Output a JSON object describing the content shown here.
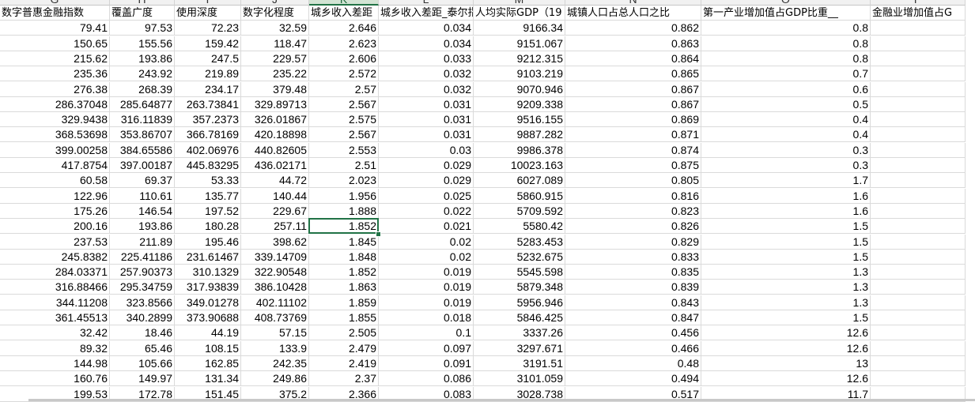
{
  "sheet": {
    "columns": [
      "G",
      "H",
      "I",
      "J",
      "K",
      "L",
      "M",
      "N",
      "O",
      "P"
    ],
    "selected_column": "K",
    "selected_cell": "K21",
    "headers": [
      "数字普惠金融指数",
      "覆盖广度",
      "使用深度",
      "数字化程度",
      "城乡收入差距",
      "城乡收入差距_泰尔指数",
      "人均实际GDP（19",
      "城镇人口占总人口之比",
      "第一产业增加值占GDP比重__",
      "金融业增加值占G"
    ],
    "rows": [
      [
        "79.41",
        "97.53",
        "72.23",
        "32.59",
        "2.646",
        "0.034",
        "9166.34",
        "0.862",
        "0.8",
        ""
      ],
      [
        "150.65",
        "155.56",
        "159.42",
        "118.47",
        "2.623",
        "0.034",
        "9151.067",
        "0.863",
        "0.8",
        ""
      ],
      [
        "215.62",
        "193.86",
        "247.5",
        "229.57",
        "2.606",
        "0.033",
        "9212.315",
        "0.864",
        "0.8",
        ""
      ],
      [
        "235.36",
        "243.92",
        "219.89",
        "235.22",
        "2.572",
        "0.032",
        "9103.219",
        "0.865",
        "0.7",
        ""
      ],
      [
        "276.38",
        "268.39",
        "234.17",
        "379.48",
        "2.57",
        "0.032",
        "9070.946",
        "0.867",
        "0.6",
        ""
      ],
      [
        "286.37048",
        "285.64877",
        "263.73841",
        "329.89713",
        "2.567",
        "0.031",
        "9209.338",
        "0.867",
        "0.5",
        ""
      ],
      [
        "329.9438",
        "316.11839",
        "357.2373",
        "326.01867",
        "2.575",
        "0.031",
        "9516.155",
        "0.869",
        "0.4",
        ""
      ],
      [
        "368.53698",
        "353.86707",
        "366.78169",
        "420.18898",
        "2.567",
        "0.031",
        "9887.282",
        "0.871",
        "0.4",
        ""
      ],
      [
        "399.00258",
        "384.65586",
        "402.06976",
        "440.82605",
        "2.553",
        "0.03",
        "9986.378",
        "0.874",
        "0.3",
        ""
      ],
      [
        "417.8754",
        "397.00187",
        "445.83295",
        "436.02171",
        "2.51",
        "0.029",
        "10023.163",
        "0.875",
        "0.3",
        ""
      ],
      [
        "60.58",
        "69.37",
        "53.33",
        "44.72",
        "2.023",
        "0.029",
        "6027.089",
        "0.805",
        "1.7",
        ""
      ],
      [
        "122.96",
        "110.61",
        "135.77",
        "140.44",
        "1.956",
        "0.025",
        "5860.915",
        "0.816",
        "1.6",
        ""
      ],
      [
        "175.26",
        "146.54",
        "197.52",
        "229.67",
        "1.888",
        "0.022",
        "5709.592",
        "0.823",
        "1.6",
        ""
      ],
      [
        "200.16",
        "193.86",
        "180.28",
        "257.11",
        "1.852",
        "0.021",
        "5580.42",
        "0.826",
        "1.5",
        ""
      ],
      [
        "237.53",
        "211.89",
        "195.46",
        "398.62",
        "1.845",
        "0.02",
        "5283.453",
        "0.829",
        "1.5",
        ""
      ],
      [
        "245.8382",
        "225.41186",
        "231.61467",
        "339.14709",
        "1.848",
        "0.02",
        "5232.675",
        "0.833",
        "1.5",
        ""
      ],
      [
        "284.03371",
        "257.90373",
        "310.1329",
        "322.90548",
        "1.852",
        "0.019",
        "5545.598",
        "0.835",
        "1.3",
        ""
      ],
      [
        "316.88466",
        "295.34759",
        "317.93839",
        "386.10428",
        "1.863",
        "0.019",
        "5879.348",
        "0.839",
        "1.3",
        ""
      ],
      [
        "344.11208",
        "323.8566",
        "349.01278",
        "402.11102",
        "1.859",
        "0.019",
        "5956.946",
        "0.843",
        "1.3",
        ""
      ],
      [
        "361.45513",
        "340.2899",
        "373.90688",
        "408.73769",
        "1.855",
        "0.018",
        "5846.425",
        "0.847",
        "1.5",
        ""
      ],
      [
        "32.42",
        "18.46",
        "44.19",
        "57.15",
        "2.505",
        "0.1",
        "3337.26",
        "0.456",
        "12.6",
        ""
      ],
      [
        "89.32",
        "65.46",
        "108.15",
        "133.9",
        "2.479",
        "0.097",
        "3297.671",
        "0.466",
        "12.6",
        ""
      ],
      [
        "144.98",
        "105.66",
        "162.85",
        "242.35",
        "2.419",
        "0.091",
        "3191.51",
        "0.48",
        "13",
        ""
      ],
      [
        "160.76",
        "149.97",
        "131.34",
        "249.86",
        "2.37",
        "0.086",
        "3101.059",
        "0.494",
        "12.6",
        ""
      ],
      [
        "199.53",
        "172.78",
        "151.45",
        "375.2",
        "2.366",
        "0.083",
        "3028.738",
        "0.517",
        "11.7",
        ""
      ]
    ]
  },
  "colors": {
    "selection": "#217346",
    "grid": "#dadada",
    "header_bg": "#f1f1f1",
    "selected_header_bg": "#d3e4d4"
  }
}
